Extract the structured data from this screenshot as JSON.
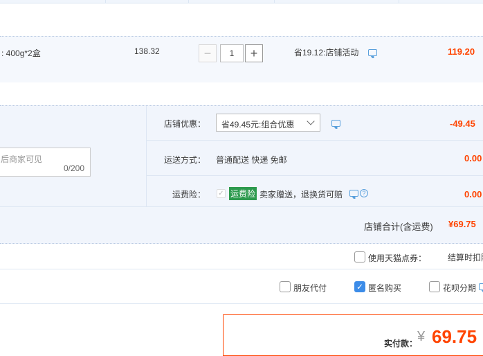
{
  "item": {
    "spec": ": 400g*2盒",
    "unit_price": "138.32",
    "quantity": "1",
    "minus": "−",
    "plus": "+",
    "saving": "省19.12:店铺活动",
    "subtotal": "119.20"
  },
  "shop": {
    "discount_label": "店铺优惠：",
    "discount_option": "省49.45元:组合优惠",
    "discount_amount": "-49.45",
    "message_placeholder": "后商家可见",
    "message_counter": "0/200",
    "shipping_label": "运送方式：",
    "shipping_value": "普通配送 快递 免邮",
    "shipping_amount": "0.00",
    "insurance_label": "运费险：",
    "insurance_badge": "运费险",
    "insurance_text": "卖家赠送，退换货可赔",
    "insurance_amount": "0.00",
    "total_label": "店铺合计(含运费)",
    "total_amount": "¥69.75"
  },
  "options": {
    "tmall_points": "使用天猫点券：",
    "points_note": "结算时扣除",
    "friend_pay": "朋友代付",
    "anonymous": "匿名购买",
    "huabei": "花呗分期"
  },
  "payment": {
    "label": "实付款：",
    "currency": "¥",
    "amount": "69.75"
  },
  "colors": {
    "accent_red": "#ff4400",
    "link_blue": "#3c8ce8",
    "badge_green": "#2d9a4e"
  }
}
